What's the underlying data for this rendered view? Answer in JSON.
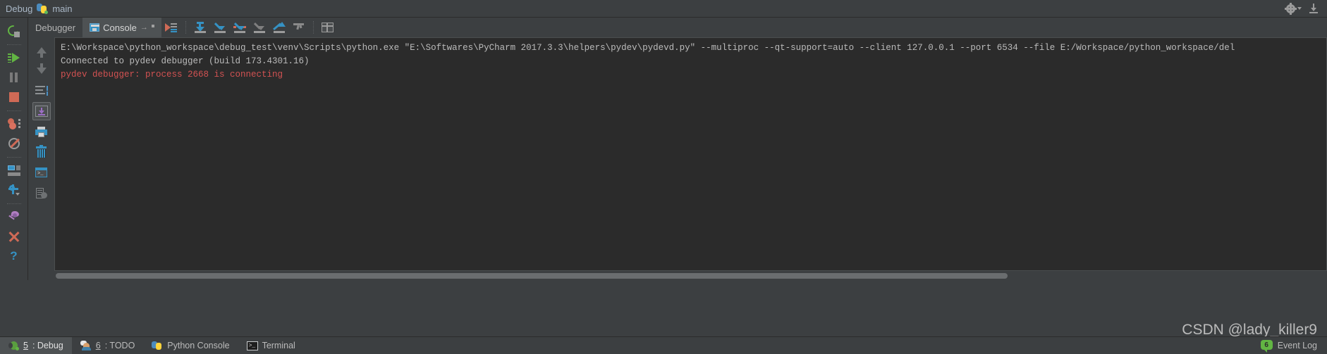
{
  "titlebar": {
    "debug_label": "Debug",
    "config_name": "main",
    "python_icon": "python-icon",
    "settings_icon": "gear-icon",
    "hide_icon": "hide-window-icon"
  },
  "run_toolbar": {
    "buttons": [
      {
        "name": "rerun-button",
        "icon": "rerun-icon",
        "tooltip": "Rerun"
      },
      {
        "name": "resume-button",
        "icon": "resume-program-icon",
        "tooltip": "Resume Program"
      },
      {
        "name": "pause-button",
        "icon": "pause-program-icon",
        "tooltip": "Pause Program"
      },
      {
        "name": "stop-button",
        "icon": "stop-icon",
        "tooltip": "Stop"
      },
      {
        "name": "view-breakpoints-button",
        "icon": "breakpoints-icon",
        "tooltip": "View Breakpoints"
      },
      {
        "name": "mute-breakpoints-button",
        "icon": "mute-breakpoints-icon",
        "tooltip": "Mute Breakpoints"
      },
      {
        "name": "restore-layout-button",
        "icon": "layout-icon",
        "tooltip": "Restore Layout"
      },
      {
        "name": "settings-button",
        "icon": "settings-gear-icon",
        "tooltip": "Settings"
      },
      {
        "name": "pin-tab-button",
        "icon": "pin-icon",
        "tooltip": "Pin Tab"
      },
      {
        "name": "close-button",
        "icon": "close-x-icon",
        "tooltip": "Close"
      },
      {
        "name": "help-button",
        "icon": "help-question-icon",
        "tooltip": "Help"
      }
    ]
  },
  "tabs": [
    {
      "name": "tab-debugger",
      "label": "Debugger",
      "active": false,
      "icon": ""
    },
    {
      "name": "tab-console",
      "label": "Console",
      "active": true,
      "icon": "console-icon",
      "suffix": "→"
    }
  ],
  "tab_toolbar": {
    "buttons": [
      {
        "name": "use-soft-wraps-button",
        "icon": "soft-wrap-icon"
      },
      {
        "name": "step-over-button",
        "icon": "step-over-icon"
      },
      {
        "name": "step-into-button",
        "icon": "step-into-icon"
      },
      {
        "name": "force-step-into-button",
        "icon": "force-step-into-icon"
      },
      {
        "name": "step-out-button",
        "icon": "step-out-icon"
      },
      {
        "name": "run-to-cursor-button",
        "icon": "run-to-cursor-icon"
      },
      {
        "name": "filter-button",
        "icon": "filter-icon"
      },
      {
        "name": "show-as-table-button",
        "icon": "table-icon"
      }
    ]
  },
  "console_gutter": {
    "buttons": [
      {
        "name": "scroll-up-button",
        "icon": "arrow-up-icon"
      },
      {
        "name": "scroll-down-button",
        "icon": "arrow-down-icon"
      },
      {
        "name": "use-soft-wraps-button",
        "icon": "soft-wraps-icon"
      },
      {
        "name": "scroll-to-end-button",
        "icon": "scroll-to-end-icon",
        "selected": true
      },
      {
        "name": "print-button",
        "icon": "print-icon"
      },
      {
        "name": "clear-all-button",
        "icon": "trash-icon"
      },
      {
        "name": "open-console-button",
        "icon": "terminal-icon"
      },
      {
        "name": "history-button",
        "icon": "history-icon"
      }
    ]
  },
  "console": {
    "lines": [
      {
        "name": "console-line-command",
        "type": "sys",
        "text": "E:\\Workspace\\python_workspace\\debug_test\\venv\\Scripts\\python.exe \"E:\\Softwares\\PyCharm 2017.3.3\\helpers\\pydev\\pydevd.py\" --multiproc --qt-support=auto --client 127.0.0.1 --port 6534 --file E:/Workspace/python_workspace/del"
      },
      {
        "name": "console-line-connected",
        "type": "sys",
        "text": "Connected to pydev debugger (build 173.4301.16)"
      },
      {
        "name": "console-line-error",
        "type": "err",
        "text": "pydev debugger: process 2668 is connecting"
      }
    ]
  },
  "statusbar": {
    "items": [
      {
        "name": "status-tab-debug",
        "number": "5",
        "label": ": Debug",
        "icon": "bug-icon",
        "active": true
      },
      {
        "name": "status-tab-todo",
        "number": "6",
        "label": ": TODO",
        "icon": "todo-icon",
        "active": false
      },
      {
        "name": "status-tab-python-console",
        "number": "",
        "label": "Python Console",
        "icon": "python-icon",
        "active": false
      },
      {
        "name": "status-tab-terminal",
        "number": "",
        "label": "Terminal",
        "icon": "terminal-icon",
        "active": false
      }
    ],
    "event_log": {
      "label": "Event Log",
      "badge": "6",
      "icon": "event-log-icon"
    }
  },
  "watermark": {
    "text": "CSDN @lady_killer9"
  },
  "colors": {
    "background": "#3c3f41",
    "console_bg": "#2b2b2b",
    "text": "#a9b7c6",
    "error": "#d25252",
    "accent_blue": "#3592c4",
    "accent_green": "#62b543"
  }
}
